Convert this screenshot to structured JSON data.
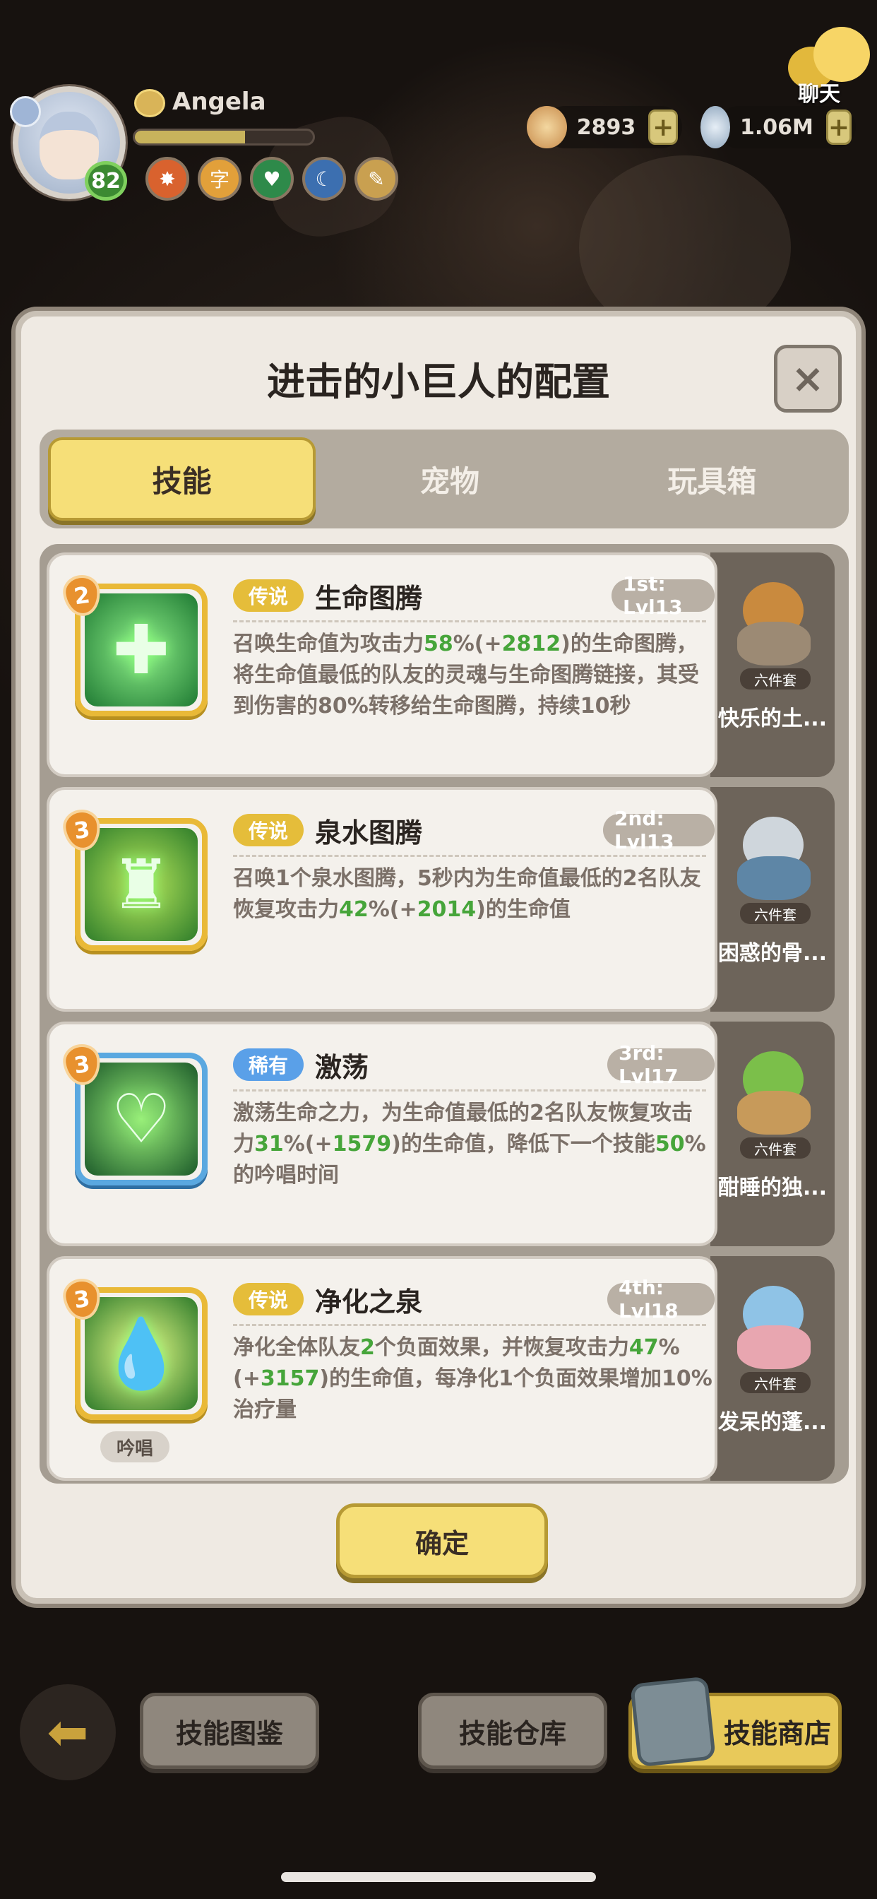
{
  "player": {
    "name": "Angela",
    "level": "82",
    "exp_fraction": 0.62
  },
  "resources": [
    {
      "icon": "shell-icon",
      "value": "2893"
    },
    {
      "icon": "pearl-icon",
      "value": "1.06M"
    }
  ],
  "chat": {
    "label": "聊天"
  },
  "modal": {
    "title": "进击的小巨人的配置",
    "tabs": [
      {
        "label": "技能",
        "active": true
      },
      {
        "label": "宠物",
        "active": false
      },
      {
        "label": "玩具箱",
        "active": false
      }
    ],
    "skills": [
      {
        "count": "2",
        "rarity": "传说",
        "rarity_color": "#e5bd3a",
        "name": "生命图腾",
        "slot": "1st: Lvl13",
        "icon": "totem-icon",
        "desc_parts": [
          "召唤生命值为攻击力",
          "58",
          "%(+",
          "2812",
          ")的生命图腾，将生命值最低的队友的灵魂与生命图腾链接，其受到伤害的80%转移给生命图腾，持续10秒"
        ],
        "pet_name": "快乐的土...",
        "pet_tag": "六件套"
      },
      {
        "count": "3",
        "rarity": "传说",
        "rarity_color": "#e5bd3a",
        "name": "泉水图腾",
        "slot": "2nd: Lvl13",
        "icon": "spring-totem-icon",
        "desc_parts": [
          "召唤1个泉水图腾，5秒内为生命值最低的2名队友恢复攻击力",
          "42",
          "%(+",
          "2014",
          ")的生命值"
        ],
        "pet_name": "困惑的骨...",
        "pet_tag": "六件套"
      },
      {
        "count": "3",
        "rarity": "稀有",
        "rarity_color": "#5aa0e8",
        "name": "激荡",
        "slot": "3rd: Lvl17",
        "icon": "heart-heal-icon",
        "desc_parts": [
          "激荡生命之力，为生命值最低的2名队友恢复攻击力",
          "31",
          "%(+",
          "1579",
          ")的生命值，降低下一个技能",
          "50",
          "%的吟唱时间"
        ],
        "pet_name": "酣睡的独...",
        "pet_tag": "六件套"
      },
      {
        "count": "3",
        "rarity": "传说",
        "rarity_color": "#e5bd3a",
        "name": "净化之泉",
        "slot": "4th: Lvl18",
        "icon": "purify-spring-icon",
        "chant": "吟唱",
        "desc_parts": [
          "净化全体队友",
          "2",
          "个负面效果，并恢复攻击力",
          "47",
          "%(+",
          "3157",
          ")的生命值，每净化1个负面效果增加10%治疗量"
        ],
        "pet_name": "发呆的蓬...",
        "pet_tag": "六件套"
      }
    ],
    "confirm_label": "确定"
  },
  "bottom_bar": {
    "buttons": [
      {
        "label": "技能图鉴"
      },
      {
        "label": "技能仓库"
      },
      {
        "label": "技能商店"
      }
    ]
  }
}
